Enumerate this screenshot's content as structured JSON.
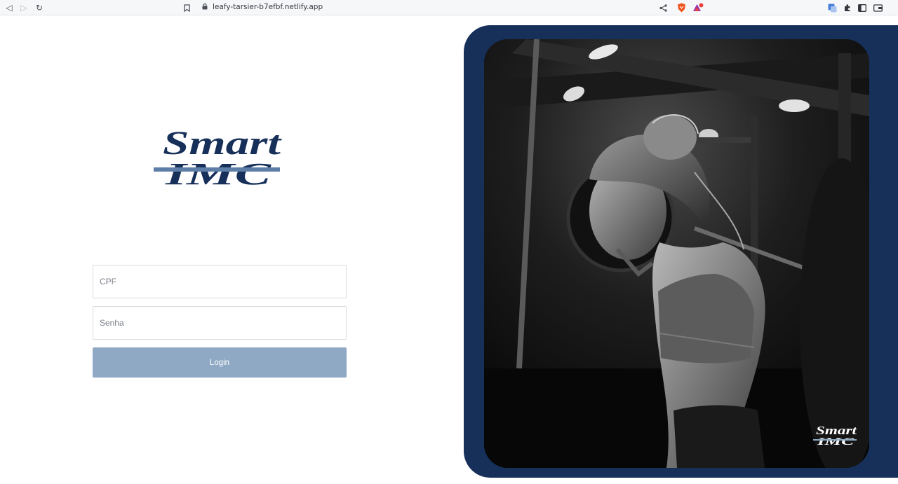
{
  "browser": {
    "url": "leafy-tarsier-b7efbf.netlify.app",
    "icons": [
      "back-icon",
      "forward-icon",
      "reload-icon",
      "bookmark-icon",
      "lock-icon",
      "share-icon",
      "brave-shield-icon",
      "brave-rewards-icon",
      "translate-icon",
      "extensions-icon",
      "sidebar-icon",
      "wallet-icon"
    ]
  },
  "brand": {
    "logo_top": "Smart",
    "logo_bottom": "IMC",
    "primary_color": "#17305a",
    "stripe_color": "#5d7ea6"
  },
  "form": {
    "cpf_placeholder": "CPF",
    "senha_placeholder": "Senha",
    "login_label": "Login",
    "button_color": "#8fa9c4"
  },
  "hero": {
    "image_description_icon": "athlete-photo",
    "watermark_top": "Smart",
    "watermark_bottom": "IMC"
  }
}
